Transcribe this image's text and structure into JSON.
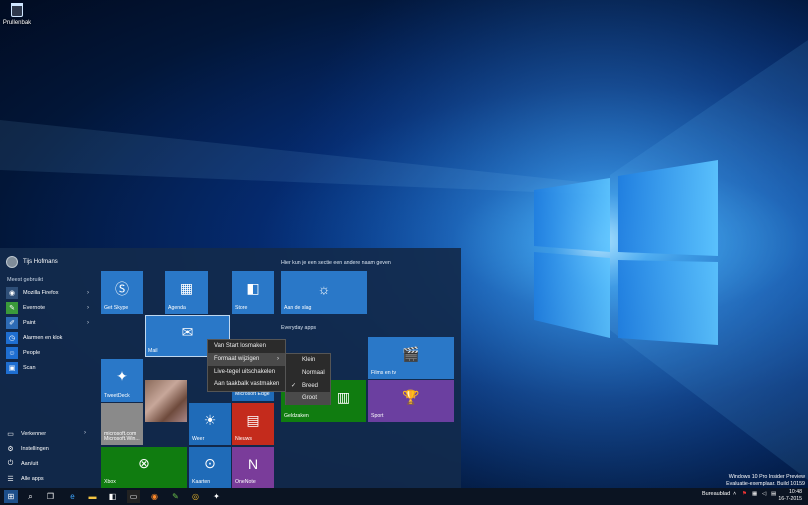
{
  "desktop": {
    "recycle_bin_label": "Prullenbak"
  },
  "start_menu": {
    "user_name": "Tijs Hofmans",
    "most_used_label": "Meest gebruikt",
    "apps": [
      {
        "label": "Mozilla Firefox",
        "icon": "firefox-icon",
        "color": "#2f4f78",
        "arrow": "›"
      },
      {
        "label": "Evernote",
        "icon": "evernote-icon",
        "color": "#3a9a3a",
        "arrow": "›"
      },
      {
        "label": "Paint",
        "icon": "paint-icon",
        "color": "#2d6bb5",
        "arrow": "›"
      },
      {
        "label": "Alarmen en klok",
        "icon": "alarm-icon",
        "color": "#1e6ed1",
        "arrow": ""
      },
      {
        "label": "People",
        "icon": "people-icon",
        "color": "#1e6ed1",
        "arrow": ""
      },
      {
        "label": "Scan",
        "icon": "scan-icon",
        "color": "#1e6ed1",
        "arrow": ""
      }
    ],
    "system": [
      {
        "label": "Verkenner",
        "icon": "folder-icon",
        "arrow": "›"
      },
      {
        "label": "Instellingen",
        "icon": "gear-icon",
        "arrow": ""
      },
      {
        "label": "Aan/uit",
        "icon": "power-icon",
        "arrow": ""
      },
      {
        "label": "Alle apps",
        "icon": "list-icon",
        "arrow": ""
      }
    ],
    "section_header": "Hier kun je een sectie een andere naam geven",
    "everyday_header": "Everyday apps",
    "tiles": {
      "skype": "Get Skype",
      "agenda": "Agenda",
      "store": "Store",
      "aan_de_slag": "Aan de slag",
      "mail": "Mail",
      "tweetdeck": "TweetDeck",
      "edge": "Microsoft Edge",
      "msword": "microsoft.com Microsoft.Win...",
      "weer": "Weer",
      "nieuws": "Nieuws",
      "xbox": "Xbox",
      "kaarten": "Kaarten",
      "onenote": "OneNote",
      "geldzaken": "Geldzaken",
      "films": "Films en tv",
      "sport": "Sport"
    }
  },
  "context_menu": {
    "items": [
      "Van Start losmaken",
      "Formaat wijzigen",
      "Live-tegel uitschakelen",
      "Aan taakbalk vastmaken"
    ],
    "submenu_arrow": "›"
  },
  "size_submenu": {
    "items": [
      "Klein",
      "Normaal",
      "Breed",
      "Groot"
    ],
    "checked": "Breed",
    "check_glyph": "✓"
  },
  "taskbar": {
    "desktop_label": "Bureaublad",
    "time": "10:48",
    "date": "16-7-2015"
  },
  "watermark": {
    "line1": "Windows 10 Pro Insider Preview",
    "line2": "Evaluatie-exemplaar. Build 10159"
  },
  "colors": {
    "tile_blue": "#2a78c8",
    "tile_green": "#107c10",
    "tile_red": "#c42b1c",
    "tile_purple": "#6b3fa0",
    "tile_gray": "#8a8a8a"
  }
}
